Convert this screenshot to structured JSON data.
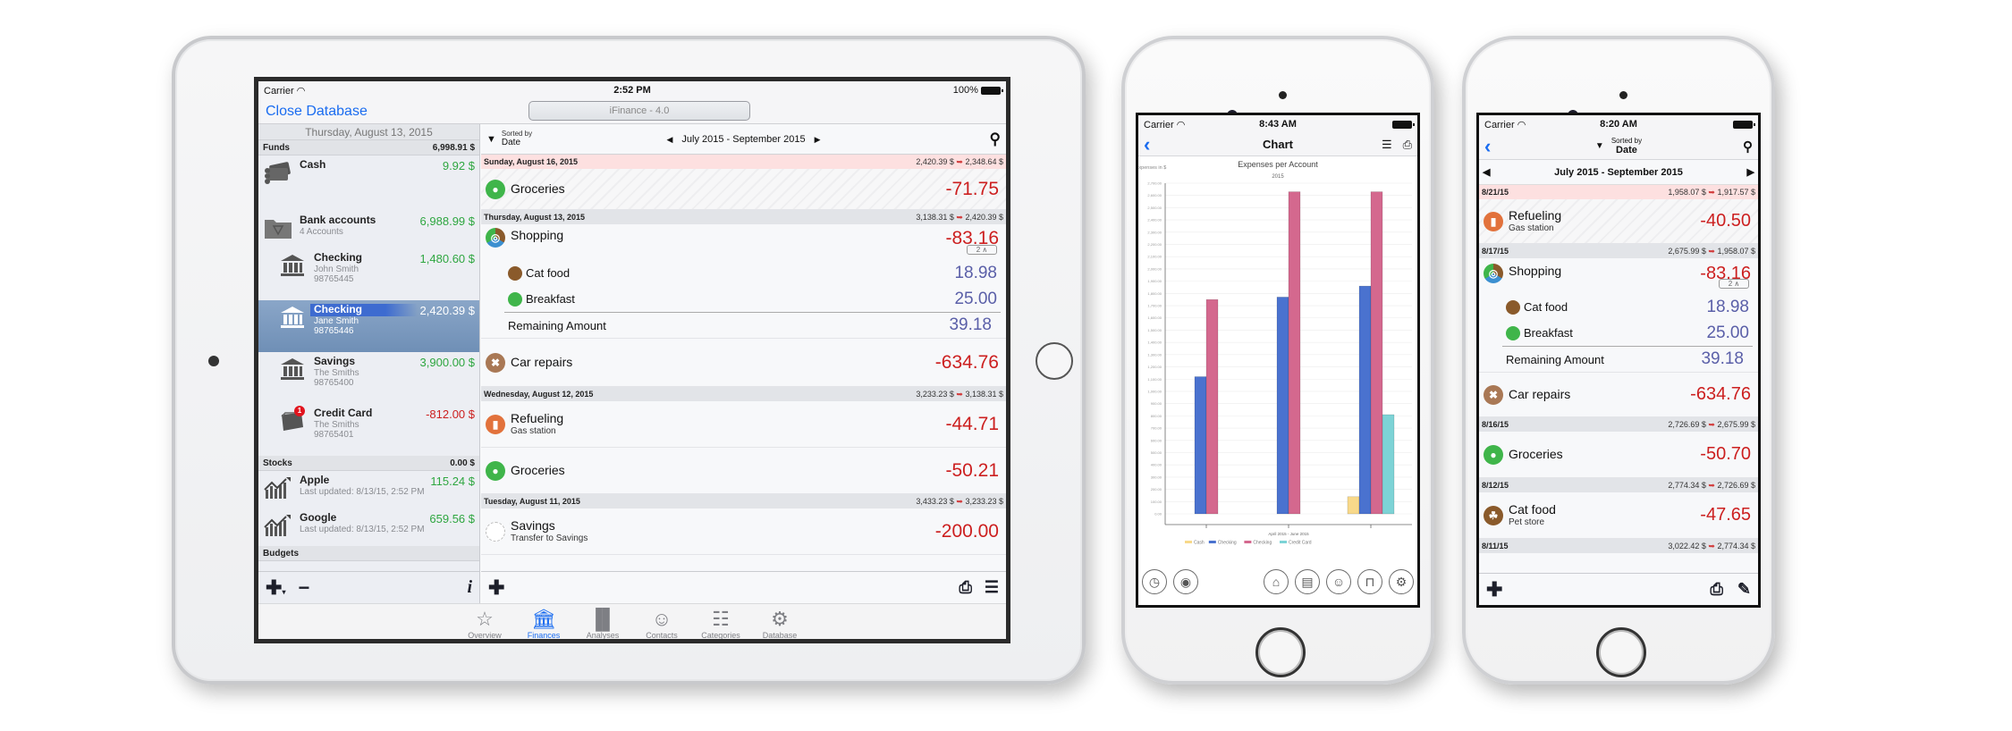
{
  "colors": {
    "accent_blue": "#1a6cf0",
    "negative_red": "#cc1f1f",
    "positive_green": "#2ea640",
    "split_purple": "#5a5fa8",
    "today_header": "#fde0e0"
  },
  "ipad": {
    "statusbar": {
      "carrier": "Carrier",
      "time": "2:52 PM",
      "battery": "100%"
    },
    "nav": {
      "close_database": "Close Database",
      "title": "iFinance - 4.0"
    },
    "sidebar": {
      "date": "Thursday, August 13, 2015",
      "sections": {
        "funds": {
          "label": "Funds",
          "total": "6,998.91 $"
        },
        "stocks": {
          "label": "Stocks",
          "total": "0.00 $"
        },
        "budgets": {
          "label": "Budgets"
        }
      },
      "accounts": [
        {
          "name": "Cash",
          "amount": "9.92 $",
          "icon": "cash-icon"
        },
        {
          "name": "Bank accounts",
          "sub": "4 Accounts",
          "amount": "6,988.99 $",
          "icon": "folder-icon"
        },
        {
          "name": "Checking",
          "sub": "John Smith",
          "number": "98765445",
          "amount": "1,480.60 $",
          "icon": "bank-icon"
        },
        {
          "name": "Checking",
          "sub": "Jane Smith",
          "number": "98765446",
          "amount": "2,420.39 $",
          "icon": "bank-icon",
          "selected": true
        },
        {
          "name": "Savings",
          "sub": "The Smiths",
          "number": "98765400",
          "amount": "3,900.00 $",
          "icon": "bank-icon"
        },
        {
          "name": "Credit Card",
          "sub": "The Smiths",
          "number": "98765401",
          "amount": "-812.00 $",
          "icon": "card-icon",
          "badge": "1"
        }
      ],
      "stocks": [
        {
          "name": "Apple",
          "sub": "Last updated: 8/13/15, 2:52 PM",
          "amount": "115.24 $"
        },
        {
          "name": "Google",
          "sub": "Last updated: 8/13/15, 2:52 PM",
          "amount": "659.56 $"
        }
      ]
    },
    "main": {
      "sort_label": "Sorted by",
      "sort_value": "Date",
      "range": "July 2015 - September 2015",
      "days": [
        {
          "date": "Sunday, August 16, 2015",
          "from": "2,420.39 $",
          "to": "2,348.64 $"
        },
        {
          "date": "Thursday, August 13, 2015",
          "from": "3,138.31 $",
          "to": "2,420.39 $"
        },
        {
          "date": "Wednesday, August 12, 2015",
          "from": "3,233.23 $",
          "to": "3,138.31 $"
        },
        {
          "date": "Tuesday, August 11, 2015",
          "from": "3,433.23 $",
          "to": "3,233.23 $"
        }
      ],
      "transactions": {
        "groceries_1": {
          "name": "Groceries",
          "amount": "-71.75"
        },
        "shopping": {
          "name": "Shopping",
          "amount": "-83.16",
          "split_count": "2"
        },
        "cat_food": {
          "name": "Cat food",
          "amount": "18.98"
        },
        "breakfast": {
          "name": "Breakfast",
          "amount": "25.00"
        },
        "remaining": {
          "name": "Remaining Amount",
          "amount": "39.18"
        },
        "car_repairs": {
          "name": "Car repairs",
          "amount": "-634.76"
        },
        "refueling": {
          "name": "Refueling",
          "sub": "Gas station",
          "amount": "-44.71"
        },
        "groceries_2": {
          "name": "Groceries",
          "amount": "-50.21"
        },
        "savings": {
          "name": "Savings",
          "sub": "Transfer to Savings",
          "amount": "-200.00"
        }
      }
    },
    "tabs": [
      {
        "label": "Overview",
        "icon": "star-icon"
      },
      {
        "label": "Finances",
        "icon": "bank-icon",
        "active": true
      },
      {
        "label": "Analyses",
        "icon": "bar-chart-icon"
      },
      {
        "label": "Contacts",
        "icon": "person-icon"
      },
      {
        "label": "Categories",
        "icon": "categories-icon"
      },
      {
        "label": "Database",
        "icon": "gear-icon"
      }
    ]
  },
  "phone_chart": {
    "statusbar": {
      "carrier": "Carrier",
      "time": "8:43 AM"
    },
    "nav": {
      "title": "Chart"
    }
  },
  "chart_data": {
    "type": "bar",
    "title": "Expenses per Account",
    "subtitle": "2015",
    "ylabel": "Expenses in $",
    "xlabel": "",
    "categories": [
      "",
      "April 2015 - June 2015",
      ""
    ],
    "ylim": [
      0,
      2700
    ],
    "ytick_step": 100,
    "grid": true,
    "legend_position": "bottom",
    "series": [
      {
        "name": "Cash",
        "color": "#f8d98a",
        "values": [
          0,
          0,
          140
        ]
      },
      {
        "name": "Checking",
        "color": "#4a72cf",
        "values": [
          1120,
          1770,
          1860
        ]
      },
      {
        "name": "Checking",
        "color": "#d4688e",
        "values": [
          1750,
          2630,
          2630
        ]
      },
      {
        "name": "Credit Card",
        "color": "#7dd3d6",
        "values": [
          0,
          0,
          810
        ]
      }
    ]
  },
  "phone_list": {
    "statusbar": {
      "carrier": "Carrier",
      "time": "8:20 AM"
    },
    "sort_label": "Sorted by",
    "sort_value": "Date",
    "range": "July 2015 - September 2015",
    "days": [
      {
        "date": "8/21/15",
        "from": "1,958.07 $",
        "to": "1,917.57 $"
      },
      {
        "date": "8/17/15",
        "from": "2,675.99 $",
        "to": "1,958.07 $"
      },
      {
        "date": "8/16/15",
        "from": "2,726.69 $",
        "to": "2,675.99 $"
      },
      {
        "date": "8/12/15",
        "from": "2,774.34 $",
        "to": "2,726.69 $"
      },
      {
        "date": "8/11/15",
        "from": "3,022.42 $",
        "to": "2,774.34 $"
      }
    ],
    "transactions": {
      "refueling": {
        "name": "Refueling",
        "sub": "Gas station",
        "amount": "-40.50"
      },
      "shopping": {
        "name": "Shopping",
        "amount": "-83.16",
        "split_count": "2"
      },
      "cat_food": {
        "name": "Cat food",
        "amount": "18.98"
      },
      "breakfast": {
        "name": "Breakfast",
        "amount": "25.00"
      },
      "remaining": {
        "name": "Remaining Amount",
        "amount": "39.18"
      },
      "car_repairs": {
        "name": "Car repairs",
        "amount": "-634.76"
      },
      "groceries": {
        "name": "Groceries",
        "amount": "-50.70"
      },
      "cat_food_2": {
        "name": "Cat food",
        "sub": "Pet store",
        "amount": "-47.65"
      }
    }
  }
}
